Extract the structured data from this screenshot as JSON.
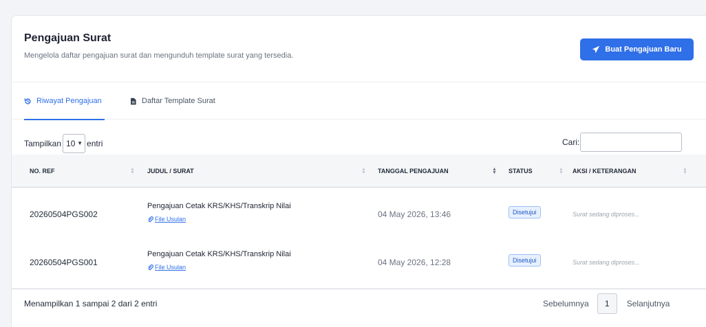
{
  "header": {
    "title": "Pengajuan Surat",
    "subtitle": "Mengelola daftar pengajuan surat dan mengunduh template surat yang tersedia.",
    "new_button_label": "Buat Pengajuan Baru"
  },
  "tabs": [
    {
      "label": "Riwayat Pengajuan",
      "active": true,
      "icon": "history-icon"
    },
    {
      "label": "Daftar Template Surat",
      "active": false,
      "icon": "file-icon"
    }
  ],
  "table_controls": {
    "show_label": "Tampilkan",
    "show_value": "10",
    "entries_label": "entri",
    "search_label": "Cari:",
    "search_value": ""
  },
  "columns": [
    "NO. REF",
    "JUDUL / SURAT",
    "TANGGAL PENGAJUAN",
    "STATUS",
    "AKSI / KETERANGAN"
  ],
  "rows": [
    {
      "ref": "20260504PGS002",
      "judul": "Pengajuan Cetak KRS/KHS/Transkrip Nilai",
      "file_link": "File Usulan",
      "tanggal": "04 May 2026, 13:46",
      "status": "Disetujui",
      "keterangan": "Surat sedang diproses..."
    },
    {
      "ref": "20260504PGS001",
      "judul": "Pengajuan Cetak KRS/KHS/Transkrip Nilai",
      "file_link": "File Usulan",
      "tanggal": "04 May 2026, 12:28",
      "status": "Disetujui",
      "keterangan": "Surat sedang diproses..."
    }
  ],
  "footer": {
    "info": "Menampilkan 1 sampai 2 dari 2 entri",
    "prev_label": "Sebelumnya",
    "current_page": "1",
    "next_label": "Selanjutnya"
  },
  "colors": {
    "accent": "#2f6fe8",
    "badge_bg": "#e8f0fe",
    "badge_text": "#1d57c6"
  }
}
